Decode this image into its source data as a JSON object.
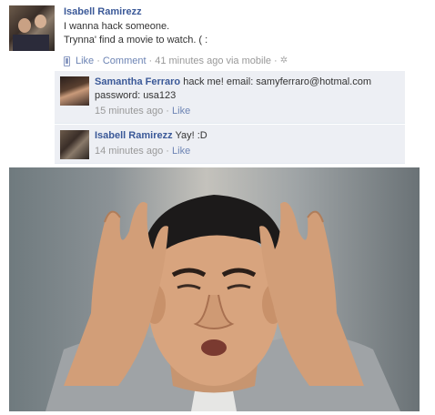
{
  "post": {
    "author": "Isabell Ramirezz",
    "line1": "I wanna hack someone.",
    "line2": "Trynna' find a movie to watch. ( :",
    "like_label": "Like",
    "comment_label": "Comment",
    "sep": "·",
    "time": "41 minutes ago via mobile"
  },
  "comments": [
    {
      "author": "Samantha Ferraro",
      "text1": "hack me! email: samyferraro@hotmal.com",
      "text2": "password: usa123",
      "time": "15 minutes ago",
      "like_label": "Like"
    },
    {
      "author": "Isabell Ramirezz",
      "text1": "Yay! :D",
      "time": "14 minutes ago",
      "like_label": "Like"
    }
  ],
  "icons": {
    "mobile": "mobile-phone-icon",
    "gear": "gear-icon"
  },
  "colors": {
    "name_link": "#3b5998",
    "action_link": "#6d84b4",
    "comment_bg": "#edeff4",
    "meta_gray": "#999999"
  }
}
